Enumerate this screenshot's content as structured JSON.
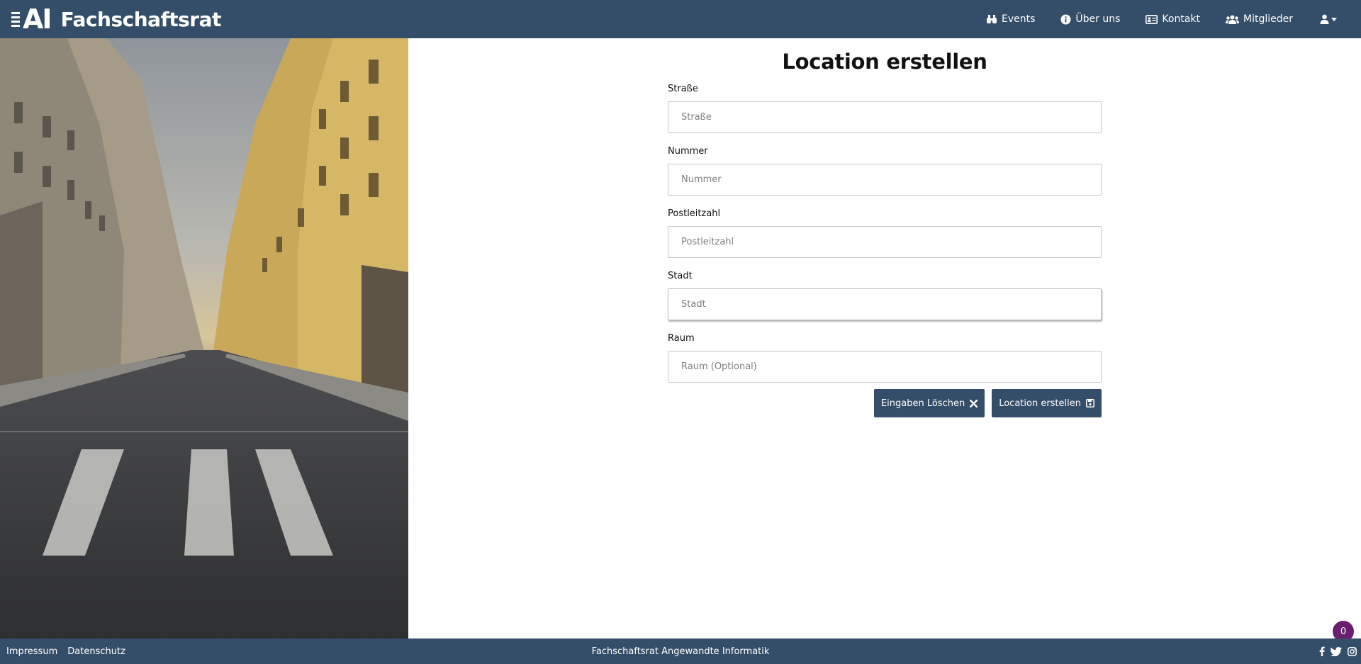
{
  "brand": {
    "logo_text": "AI",
    "title": "Fachschaftsrat"
  },
  "nav": {
    "items": [
      {
        "label": "Events",
        "icon": "binoculars-icon"
      },
      {
        "label": "Über uns",
        "icon": "info-circle-icon"
      },
      {
        "label": "Kontakt",
        "icon": "address-card-icon"
      },
      {
        "label": "Mitglieder",
        "icon": "users-icon"
      }
    ],
    "user_icon": "user-icon"
  },
  "form": {
    "title": "Location erstellen",
    "fields": [
      {
        "label": "Straße",
        "placeholder": "Straße",
        "value": ""
      },
      {
        "label": "Nummer",
        "placeholder": "Nummer",
        "value": ""
      },
      {
        "label": "Postleitzahl",
        "placeholder": "Postleitzahl",
        "value": ""
      },
      {
        "label": "Stadt",
        "placeholder": "Stadt",
        "value": ""
      },
      {
        "label": "Raum",
        "placeholder": "Raum (Optional)",
        "value": ""
      }
    ],
    "clear_button": "Eingaben Löschen",
    "submit_button": "Location erstellen"
  },
  "footer": {
    "impressum": "Impressum",
    "datenschutz": "Datenschutz",
    "center_text": "Fachschaftsrat Angewandte Informatik",
    "social_icons": [
      "facebook-icon",
      "twitter-icon",
      "instagram-icon"
    ]
  },
  "notification_badge": "0",
  "colors": {
    "primary": "#344d69",
    "badge": "#6a1f6e"
  }
}
